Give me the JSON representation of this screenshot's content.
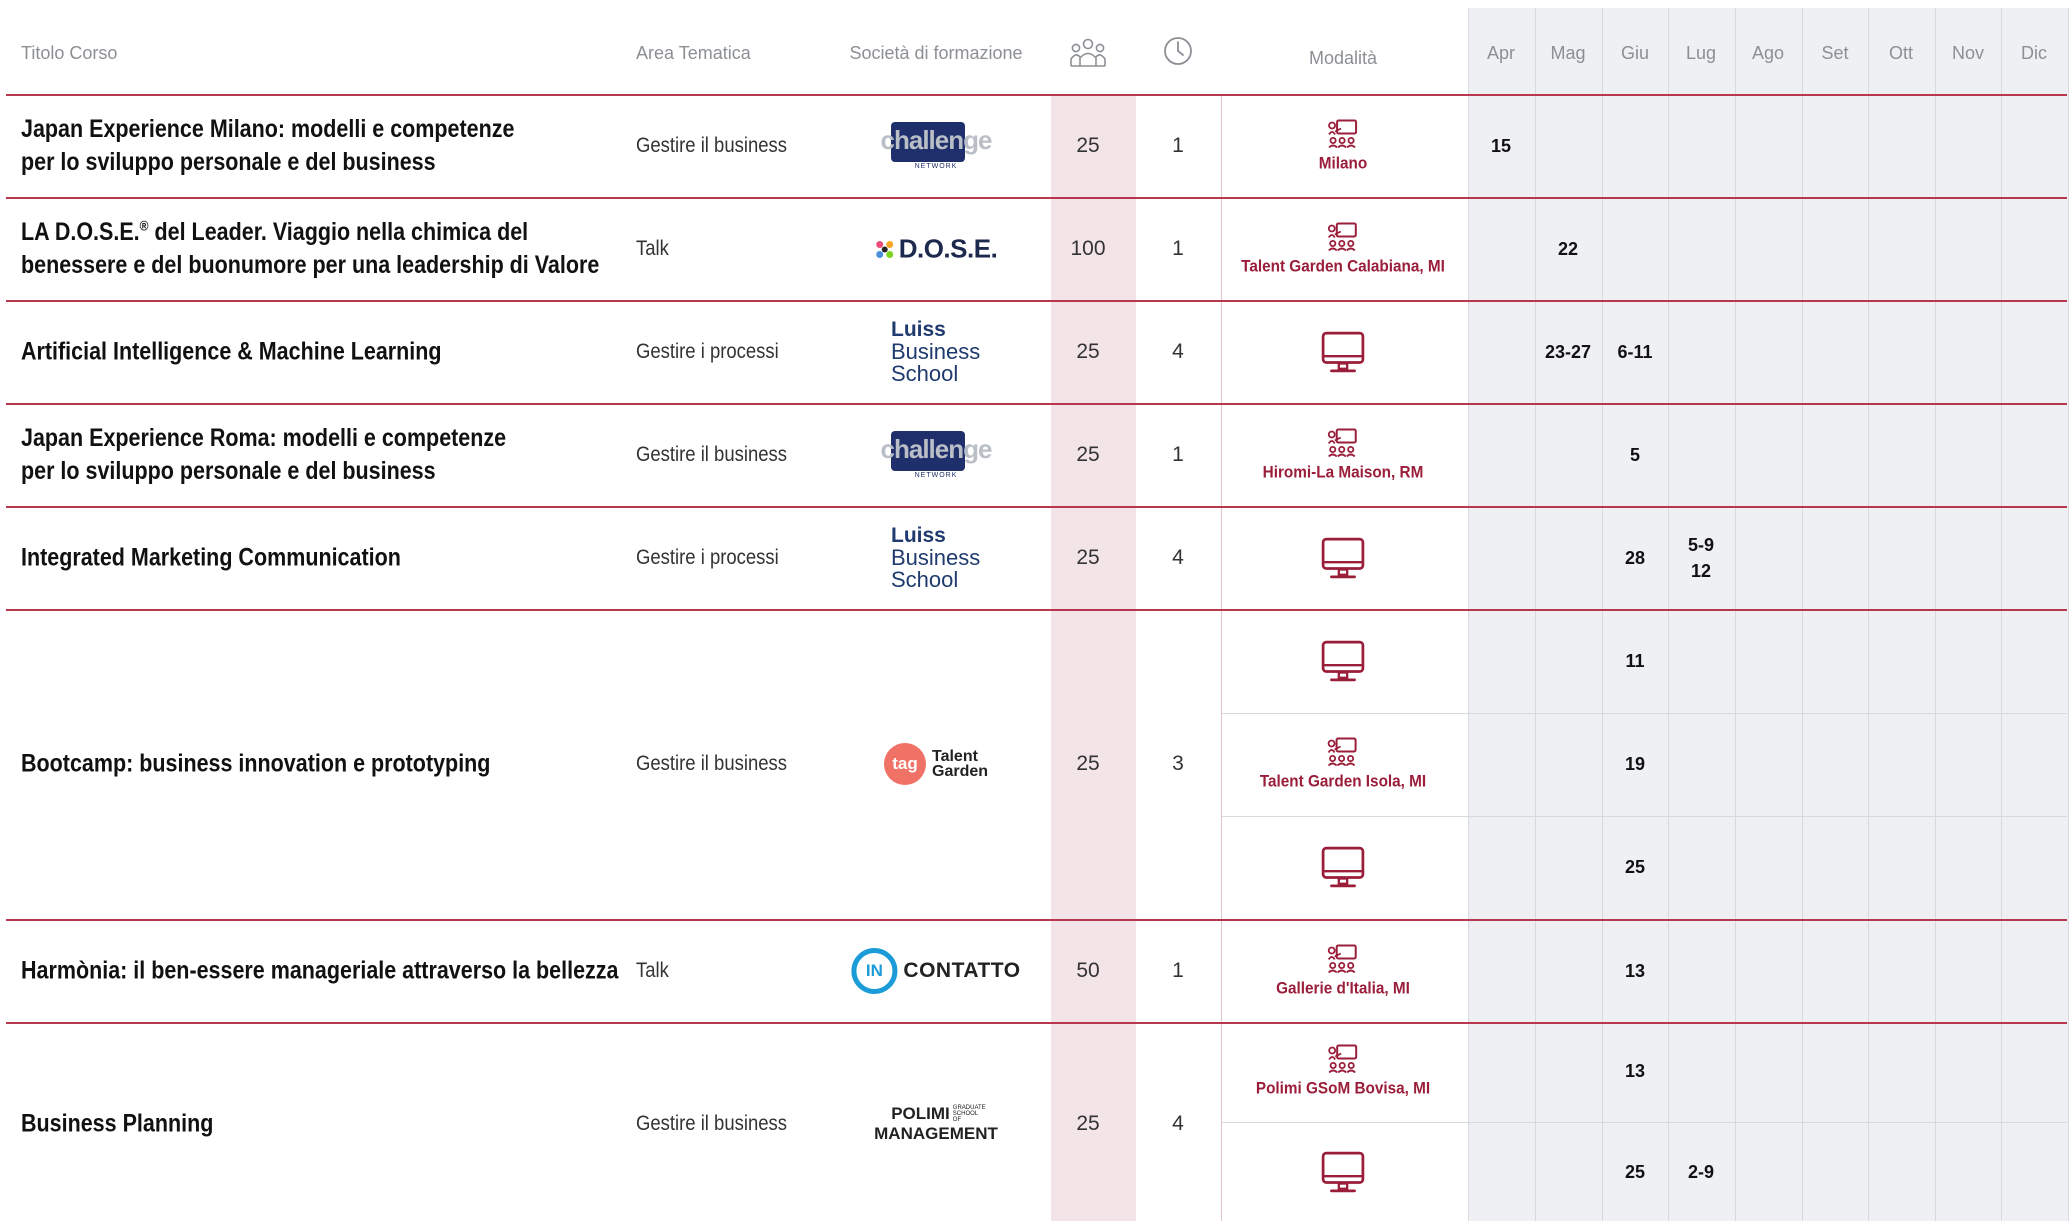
{
  "header": {
    "titolo": "Titolo Corso",
    "area": "Area Tematica",
    "societa": "Società di formazione",
    "modalita": "Modalità",
    "participants_icon": "people-icon",
    "duration_icon": "clock-icon",
    "months": [
      "Apr",
      "Mag",
      "Giu",
      "Lug",
      "Ago",
      "Set",
      "Ott",
      "Nov",
      "Dic"
    ]
  },
  "colors": {
    "accent": "#9a1e3a",
    "rule": "#b8374f",
    "participants_band": "#f3e4e8",
    "month_band": "#eef0f3"
  },
  "logos": {
    "challenge": {
      "word": "challenge",
      "sub": "NETWORK"
    },
    "dose": {
      "word": "D.O.S.E."
    },
    "luiss": {
      "l1": "Luiss",
      "l2": "Business",
      "l3": "School"
    },
    "tag": {
      "badge": "tag",
      "l1": "Talent",
      "l2": "Garden"
    },
    "incontatto": {
      "in": "IN",
      "word": "CONTATTO"
    },
    "polimi": {
      "l1": "POLIMI",
      "l2": "MANAGEMENT",
      "side": "GRADUATE SCHOOL OF"
    }
  },
  "courses": [
    {
      "title1": "Japan Experience Milano: modelli e competenze",
      "title2": "per lo sviluppo personale e del business",
      "area": "Gestire il business",
      "participants": "25",
      "duration": "1",
      "sessions": [
        {
          "mode_icon": "classroom-icon",
          "location": "Milano",
          "days": {
            "apr": "15"
          }
        }
      ]
    },
    {
      "title1": "LA D.O.S.E.",
      "title_sup": "®",
      "title1b": " del Leader. Viaggio nella chimica del",
      "title2": "benessere e del buonumore per una leadership di Valore",
      "area": "Talk",
      "participants": "100",
      "duration": "1",
      "sessions": [
        {
          "mode_icon": "classroom-icon",
          "location": "Talent Garden Calabiana, MI",
          "days": {
            "mag": "22"
          }
        }
      ]
    },
    {
      "title1": "Artificial Intelligence & Machine Learning",
      "area": "Gestire i processi",
      "participants": "25",
      "duration": "4",
      "sessions": [
        {
          "mode_icon": "monitor-icon",
          "days": {
            "mag": "23-27",
            "giu": "6-11"
          }
        }
      ]
    },
    {
      "title1": "Japan Experience Roma: modelli e competenze",
      "title2": "per lo sviluppo personale e del business",
      "area": "Gestire il business",
      "participants": "25",
      "duration": "1",
      "sessions": [
        {
          "mode_icon": "classroom-icon",
          "location": "Hiromi-La Maison, RM",
          "days": {
            "giu": "5"
          }
        }
      ]
    },
    {
      "title1": "Integrated Marketing Communication",
      "area": "Gestire i processi",
      "participants": "25",
      "duration": "4",
      "sessions": [
        {
          "mode_icon": "monitor-icon",
          "days": {
            "giu": "28",
            "lug1": "5-9",
            "lug2": "12"
          }
        }
      ]
    },
    {
      "title1": "Bootcamp: business innovation e prototyping",
      "area": "Gestire il business",
      "participants": "25",
      "duration": "3",
      "sessions": [
        {
          "mode_icon": "monitor-icon",
          "days": {
            "giu": "11"
          }
        },
        {
          "mode_icon": "classroom-icon",
          "location": "Talent Garden Isola, MI",
          "days": {
            "giu": "19"
          }
        },
        {
          "mode_icon": "monitor-icon",
          "days": {
            "giu": "25"
          }
        }
      ]
    },
    {
      "title1": "Harmònia: il ben-essere manageriale attraverso la bellezza",
      "area": "Talk",
      "participants": "50",
      "duration": "1",
      "sessions": [
        {
          "mode_icon": "classroom-icon",
          "location": "Gallerie d'Italia, MI",
          "days": {
            "giu": "13"
          }
        }
      ]
    },
    {
      "title1": "Business Planning",
      "area": "Gestire il business",
      "participants": "25",
      "duration": "4",
      "sessions": [
        {
          "mode_icon": "classroom-icon",
          "location": "Polimi GSoM Bovisa, MI",
          "days": {
            "giu": "13"
          }
        },
        {
          "mode_icon": "monitor-icon",
          "days": {
            "giu": "25",
            "lug": "2-9"
          }
        }
      ]
    }
  ]
}
